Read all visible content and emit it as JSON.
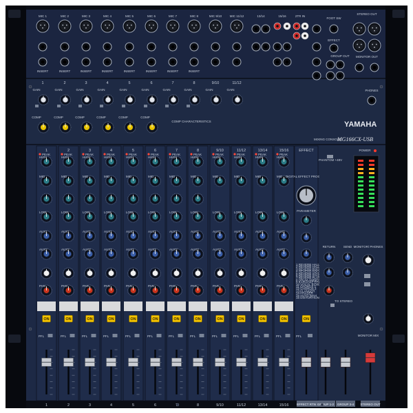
{
  "brand": {
    "name": "YAMAHA",
    "model": "MG166CX-USB",
    "subtitle": "MIXING CONSOLE"
  },
  "colors": {
    "panel": "#1e2a44",
    "panel_dark": "#141d33",
    "frame": "#0a0d14",
    "knob_yellow": "#e8c400",
    "knob_red": "#c8341c",
    "knob_blue": "#3a5ea8",
    "knob_teal": "#2a7b86",
    "on_button": "#f2c200",
    "stereo_fader": "#d63a3a"
  },
  "channels": [
    {
      "label": "1",
      "mic_label": "MIC 1"
    },
    {
      "label": "2",
      "mic_label": "MIC 2"
    },
    {
      "label": "3",
      "mic_label": "MIC 3"
    },
    {
      "label": "4",
      "mic_label": "MIC 4"
    },
    {
      "label": "5",
      "mic_label": "MIC 5"
    },
    {
      "label": "6",
      "mic_label": "MIC 6"
    },
    {
      "label": "7",
      "mic_label": "MIC 7"
    },
    {
      "label": "8",
      "mic_label": "MIC 8"
    },
    {
      "label": "9/10",
      "mic_label": "MIC 9/10"
    },
    {
      "label": "11/12",
      "mic_label": "MIC 11/12"
    },
    {
      "label": "13/14",
      "mic_label": ""
    },
    {
      "label": "15/16",
      "mic_label": ""
    }
  ],
  "labels": {
    "effect": "EFFECT",
    "power": "POWER",
    "stereo_out": "STEREO OUT",
    "monitor_out": "MONITOR OUT",
    "phones": "PHONES",
    "gain": "GAIN",
    "comp": "COMP",
    "peak": "PEAK",
    "high": "HIGH",
    "mid": "MID",
    "low": "LOW",
    "aux1": "AUX1",
    "aux2": "AUX2",
    "pan": "PAN",
    "on": "ON",
    "pfl": "PFL",
    "return": "RETURN",
    "send": "SEND",
    "monitor_phones": "MONITOR/ PHONES",
    "digital_effect": "DIGITAL EFFECT PROGRAM",
    "parameter": "PARAMETER",
    "effect_rtn": "EFFECT RTN",
    "group_12": "GROUP 1-2",
    "group_34": "GROUP 3-4",
    "stereo_out_bottom": "STEREO OUT",
    "insert": "INSERT",
    "foot_sw": "FOOT SW",
    "group_out": "GROUP OUT",
    "effect_send": "EFFECT",
    "monitor_mix": "MONITOR MIX",
    "to_stereo": "TO STEREO",
    "comp_threshold": "COMP CHARACTERISTICS",
    "usb_phantom": "PHANTOM +48V",
    "st_in": "2TR IN"
  },
  "effect_programs": [
    "1 REVERB HALL 1",
    "2 REVERB HALL 2",
    "3 REVERB ROOM 1",
    "4 REVERB ROOM 2",
    "5 REVERB STAGE 1",
    "6 REVERB STAGE 2",
    "7 REVERB PLATE",
    "8 DRUM AMBIENCE",
    "9 KARAOKE ECHO",
    "10 VOCAL ECHO",
    "11 CHORUS 1",
    "12 CHORUS 2",
    "13 FLANGER",
    "14 PHASER",
    "15 AUTO WAH",
    "16 DISTORTION"
  ],
  "fader_levels": {
    "channels": [
      0.72,
      0.72,
      0.72,
      0.72,
      0.72,
      0.72,
      0.72,
      0.72,
      0.72,
      0.72,
      0.72,
      0.72
    ],
    "effect_rtn": 0.72,
    "group_12": 0.72,
    "group_34": 0.72,
    "stereo_out": 0.82
  },
  "meter": {
    "rows": 12
  }
}
